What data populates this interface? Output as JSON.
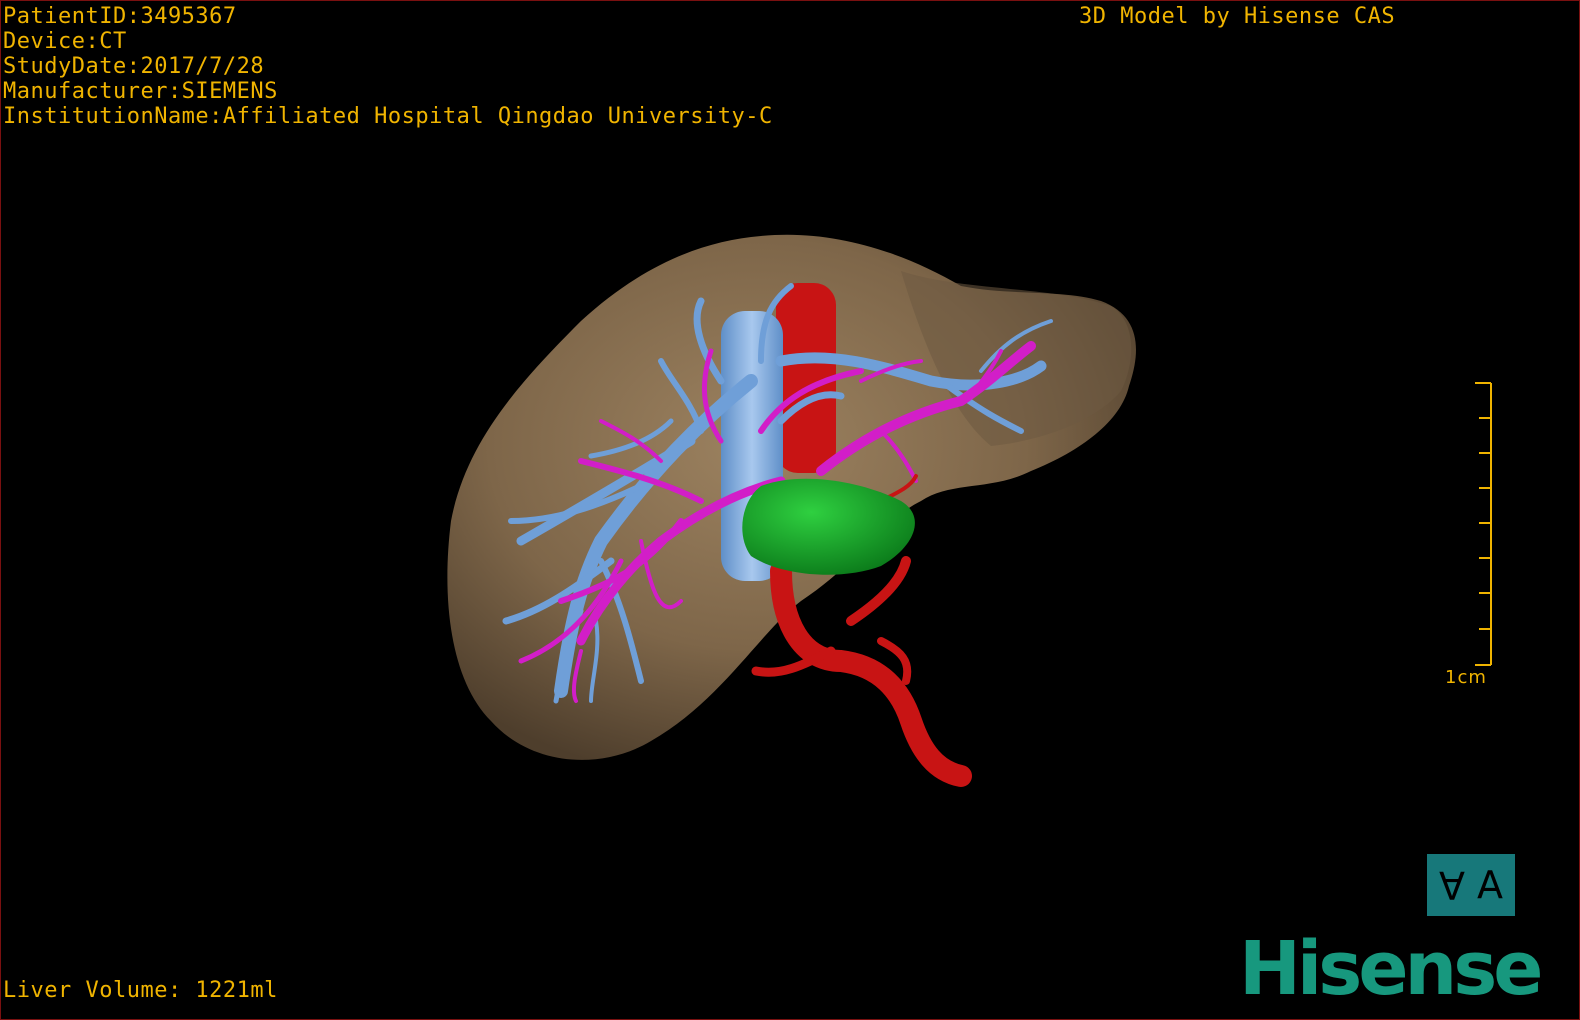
{
  "header": {
    "patient_id": "PatientID:3495367",
    "device": "Device:CT",
    "study_date": "StudyDate:2017/7/28",
    "manufacturer": "Manufacturer:SIEMENS",
    "institution": "InstitutionName:Affiliated Hospital Qingdao University-C",
    "model_credit": "3D Model by Hisense CAS"
  },
  "footer": {
    "liver_volume": "Liver Volume: 1221ml"
  },
  "scale": {
    "label": "1cm"
  },
  "orientation": {
    "left_glyph": "A",
    "right_glyph": "A"
  },
  "brand": {
    "logo_text": "Hisense"
  },
  "colors": {
    "text": "#f0b400",
    "liver": "#8a7255",
    "hepatic_vein": "#6f9fd8",
    "portal_vein": "#d21ec8",
    "artery": "#c81414",
    "tumor": "#12a82a",
    "brand": "#17987e",
    "orientation_box": "#17787a"
  }
}
